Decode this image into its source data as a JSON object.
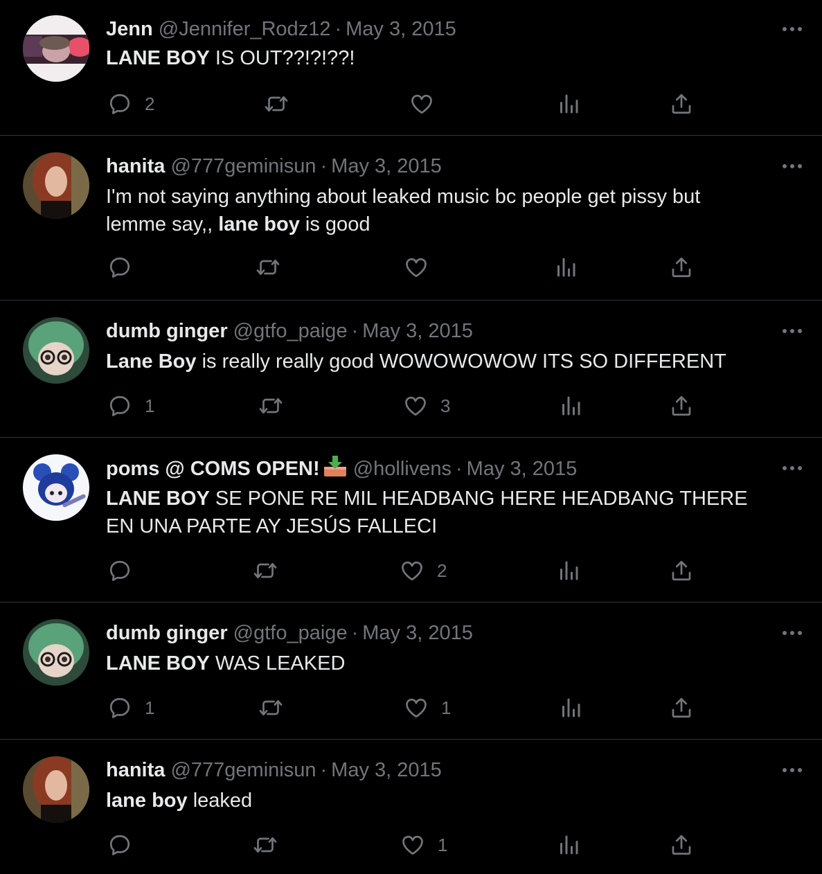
{
  "tweets": [
    {
      "name": "Jenn",
      "handle": "@Jennifer_Rodz12",
      "separator": "·",
      "date": "May 3, 2015",
      "text_bold": "LANE BOY",
      "text_rest": " IS OUT??!?!??!",
      "reply_count": "2",
      "like_count": ""
    },
    {
      "name": "hanita",
      "handle": "@777geminisun",
      "separator": "·",
      "date": "May 3, 2015",
      "text_before": "I'm not saying anything about leaked music bc people get pissy but lemme say,, ",
      "text_bold": "lane boy",
      "text_rest": " is good",
      "reply_count": "",
      "like_count": ""
    },
    {
      "name": "dumb ginger",
      "handle": "@gtfo_paige",
      "separator": "·",
      "date": "May 3, 2015",
      "text_bold": "Lane Boy",
      "text_rest": " is really really good WOWOWOWOW ITS SO DIFFERENT",
      "reply_count": "1",
      "like_count": "3"
    },
    {
      "name": "poms @ COMS OPEN!",
      "name_emoji": "inbox-tray-icon",
      "handle": "@hollivens",
      "separator": "·",
      "date": "May 3, 2015",
      "text_bold": "LANE BOY",
      "text_rest": " SE PONE RE MIL HEADBANG HERE HEADBANG THERE EN UNA PARTE AY JESÚS FALLECI",
      "reply_count": "",
      "like_count": "2"
    },
    {
      "name": "dumb ginger",
      "handle": "@gtfo_paige",
      "separator": "·",
      "date": "May 3, 2015",
      "text_bold": "LANE BOY",
      "text_rest": " WAS LEAKED",
      "reply_count": "1",
      "like_count": "1"
    },
    {
      "name": "hanita",
      "handle": "@777geminisun",
      "separator": "·",
      "date": "May 3, 2015",
      "text_bold": "lane boy",
      "text_rest": " leaked",
      "reply_count": "",
      "like_count": "1"
    }
  ],
  "icons": {
    "reply": "reply-icon",
    "retweet": "retweet-icon",
    "like": "heart-icon",
    "views": "views-icon",
    "share": "share-icon",
    "more": "more-icon"
  },
  "colors": {
    "background": "#000000",
    "text": "#e7e9ea",
    "muted": "#71767b",
    "divider": "#2f3336"
  }
}
